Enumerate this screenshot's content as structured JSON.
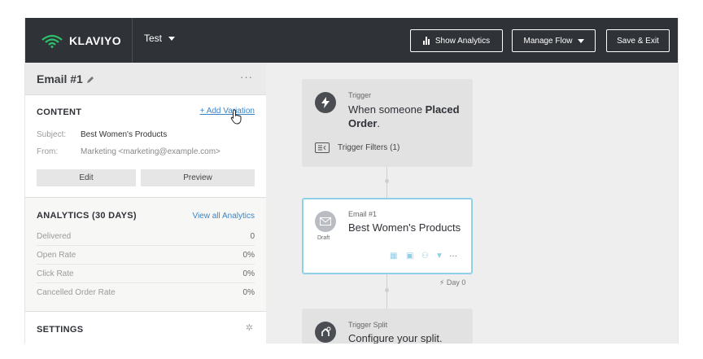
{
  "header": {
    "logo_text": "KLAVIYO",
    "flow_name": "Test",
    "show_analytics": "Show Analytics",
    "manage_flow": "Manage Flow",
    "save_exit": "Save & Exit"
  },
  "sidebar": {
    "title": "Email #1",
    "more": "···",
    "content": {
      "heading": "CONTENT",
      "add_variation": "+ Add Variation",
      "subject_label": "Subject:",
      "subject_value": "Best Women's Products",
      "from_label": "From:",
      "from_value": "Marketing <marketing@example.com>",
      "edit": "Edit",
      "preview": "Preview"
    },
    "analytics": {
      "heading": "ANALYTICS (30 DAYS)",
      "view_all": "View all Analytics",
      "rows": [
        {
          "label": "Delivered",
          "value": "0"
        },
        {
          "label": "Open Rate",
          "value": "0%"
        },
        {
          "label": "Click Rate",
          "value": "0%"
        },
        {
          "label": "Cancelled Order Rate",
          "value": "0%"
        }
      ]
    },
    "settings": {
      "heading": "SETTINGS"
    }
  },
  "canvas": {
    "trigger": {
      "label": "Trigger",
      "text_pre": "When someone ",
      "text_bold": "Placed Order",
      "text_post": ".",
      "filters": "Trigger Filters (1)"
    },
    "email": {
      "label": "Email #1",
      "title": "Best Women's Products",
      "status": "Draft",
      "more": "···"
    },
    "delay": "Day 0",
    "split": {
      "label": "Trigger Split",
      "text": "Configure your split."
    }
  },
  "colors": {
    "header_bg": "#2f3237",
    "link": "#3d84c6",
    "brand_green": "#2dc26b",
    "email_border": "#8fcfe8"
  }
}
